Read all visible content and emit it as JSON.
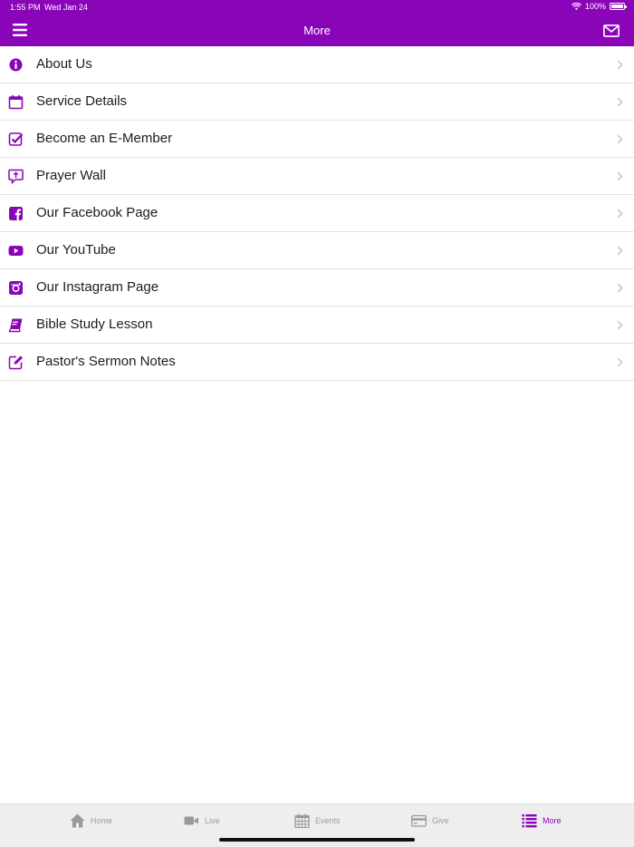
{
  "status_bar": {
    "time": "1:55 PM",
    "date": "Wed Jan 24",
    "battery": "100%"
  },
  "nav": {
    "title": "More",
    "menu_icon": "hamburger-menu-icon",
    "mail_icon": "envelope-icon"
  },
  "colors": {
    "accent": "#8a05b8",
    "chevron": "#c4c4c8",
    "tab_inactive": "#9a9a9a"
  },
  "menu_items": [
    {
      "label": "About Us",
      "icon": "info-circle-icon"
    },
    {
      "label": "Service Details",
      "icon": "calendar-icon"
    },
    {
      "label": "Become an E-Member",
      "icon": "checkbox-icon"
    },
    {
      "label": "Prayer Wall",
      "icon": "prayer-chat-icon"
    },
    {
      "label": "Our Facebook Page",
      "icon": "facebook-icon"
    },
    {
      "label": "Our YouTube",
      "icon": "youtube-icon"
    },
    {
      "label": "Our Instagram Page",
      "icon": "instagram-icon"
    },
    {
      "label": "Bible Study Lesson",
      "icon": "book-icon"
    },
    {
      "label": "Pastor's Sermon Notes",
      "icon": "edit-note-icon"
    }
  ],
  "tabs": [
    {
      "label": "Home",
      "icon": "home-icon",
      "active": false
    },
    {
      "label": "Live",
      "icon": "video-camera-icon",
      "active": false
    },
    {
      "label": "Events",
      "icon": "calendar-grid-icon",
      "active": false
    },
    {
      "label": "Give",
      "icon": "credit-card-icon",
      "active": false
    },
    {
      "label": "More",
      "icon": "list-icon",
      "active": true
    }
  ]
}
